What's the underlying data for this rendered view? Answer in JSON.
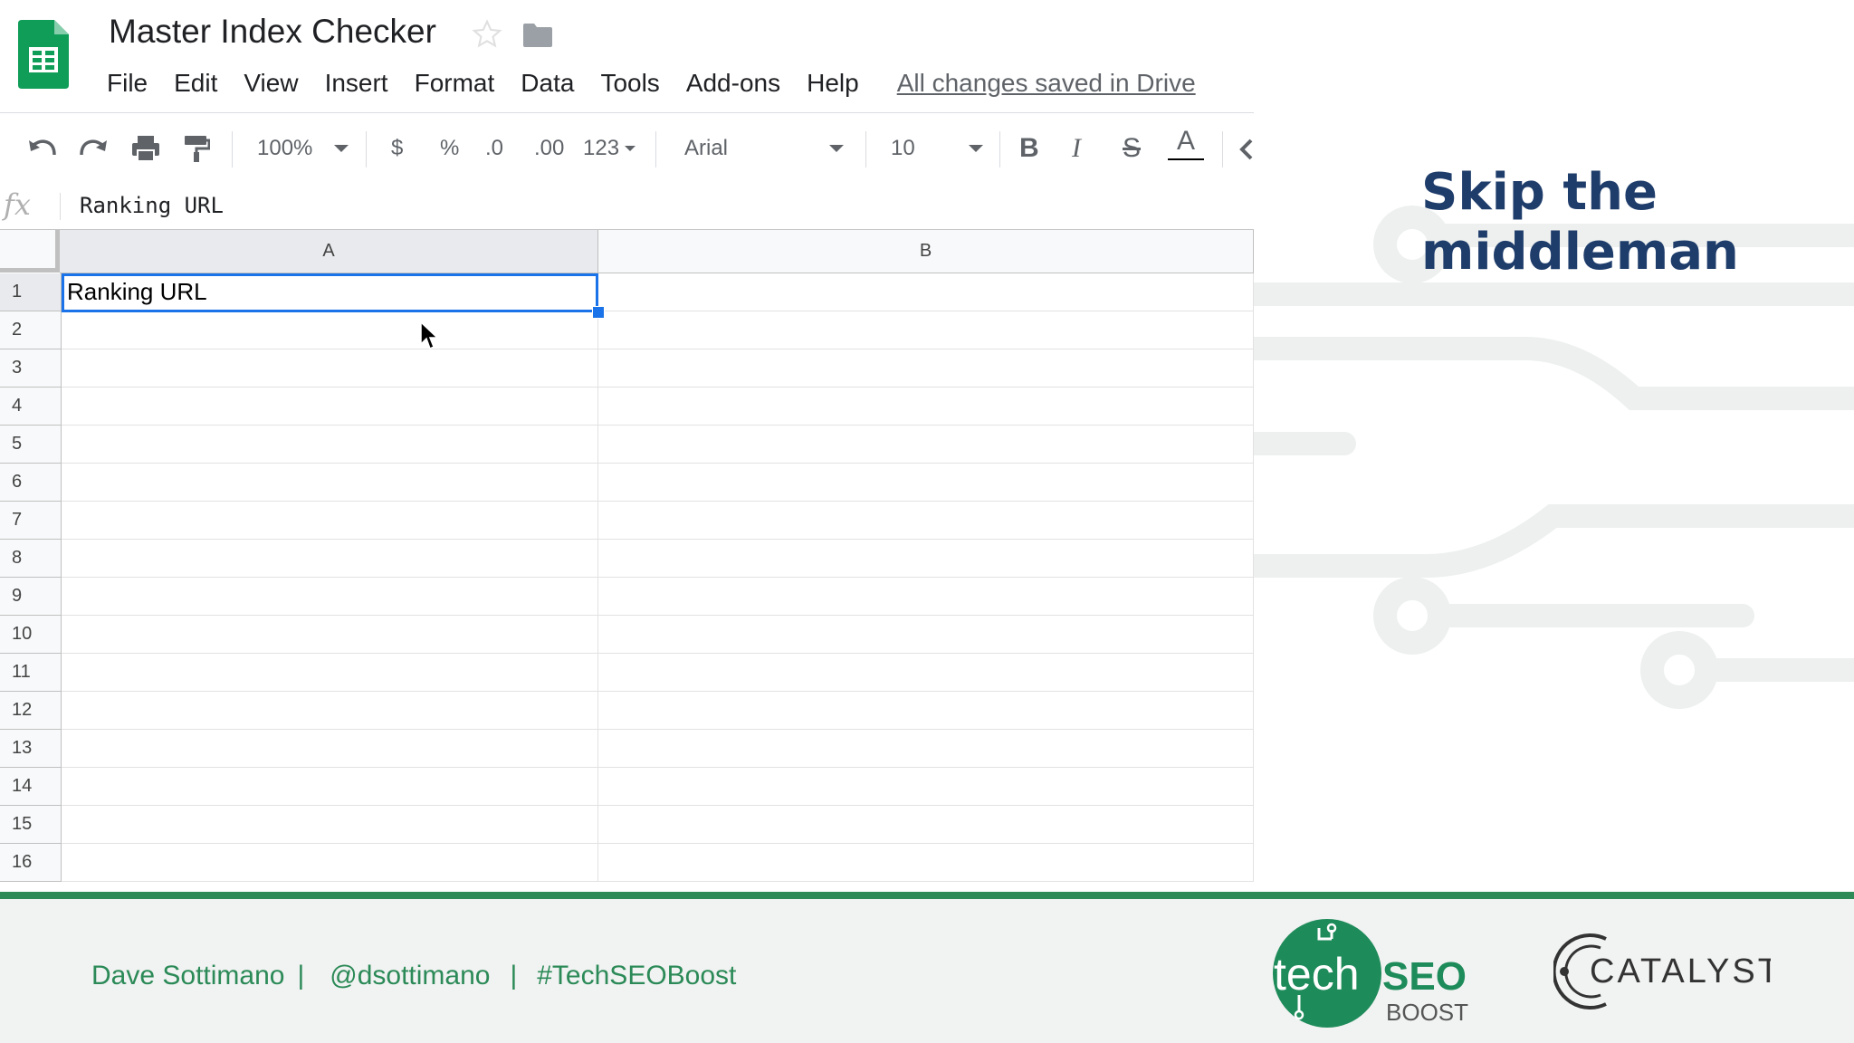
{
  "document": {
    "title": "Master Index Checker",
    "saved_status": "All changes saved in Drive"
  },
  "menu": [
    "File",
    "Edit",
    "View",
    "Insert",
    "Format",
    "Data",
    "Tools",
    "Add-ons",
    "Help"
  ],
  "toolbar": {
    "zoom": "100%",
    "currency": "$",
    "percent": "%",
    "decrease_decimal": ".0",
    "increase_decimal": ".00",
    "more_formats": "123",
    "font": "Arial",
    "font_size": "10",
    "bold": "B",
    "italic": "I",
    "strikethrough": "S",
    "text_color": "A",
    "icons": [
      "undo-icon",
      "redo-icon",
      "print-icon",
      "paint-format-icon",
      "bold-icon",
      "italic-icon",
      "strikethrough-icon",
      "text-color-icon"
    ]
  },
  "formula_bar": {
    "fx": "fx",
    "value": "Ranking URL"
  },
  "grid": {
    "columns": [
      "A",
      "B"
    ],
    "rows": [
      {
        "num": "1",
        "a": "Ranking URL",
        "b": ""
      },
      {
        "num": "2",
        "a": "",
        "b": ""
      },
      {
        "num": "3",
        "a": "",
        "b": ""
      },
      {
        "num": "4",
        "a": "",
        "b": ""
      },
      {
        "num": "5",
        "a": "",
        "b": ""
      },
      {
        "num": "6",
        "a": "",
        "b": ""
      },
      {
        "num": "7",
        "a": "",
        "b": ""
      },
      {
        "num": "8",
        "a": "",
        "b": ""
      },
      {
        "num": "9",
        "a": "",
        "b": ""
      },
      {
        "num": "10",
        "a": "",
        "b": ""
      },
      {
        "num": "11",
        "a": "",
        "b": ""
      },
      {
        "num": "12",
        "a": "",
        "b": ""
      },
      {
        "num": "13",
        "a": "",
        "b": ""
      },
      {
        "num": "14",
        "a": "",
        "b": ""
      },
      {
        "num": "15",
        "a": "",
        "b": ""
      },
      {
        "num": "16",
        "a": "",
        "b": ""
      }
    ],
    "selected_cell": "A1"
  },
  "slide": {
    "heading": "Skip the middleman"
  },
  "footer": {
    "author": "Dave Sottimano",
    "sep1": "|",
    "handle": "@dsottimano",
    "sep2": "|",
    "hashtag": "#TechSEOBoost",
    "logo1_text": "tech",
    "logo1_seo": "SEO",
    "logo1_boost": "BOOST",
    "logo2_text": "CATALYST"
  },
  "colors": {
    "heading": "#1f3d6b",
    "footer_green": "#2b8a57",
    "selection_blue": "#1a73e8",
    "sheets_green": "#0f9d58"
  }
}
